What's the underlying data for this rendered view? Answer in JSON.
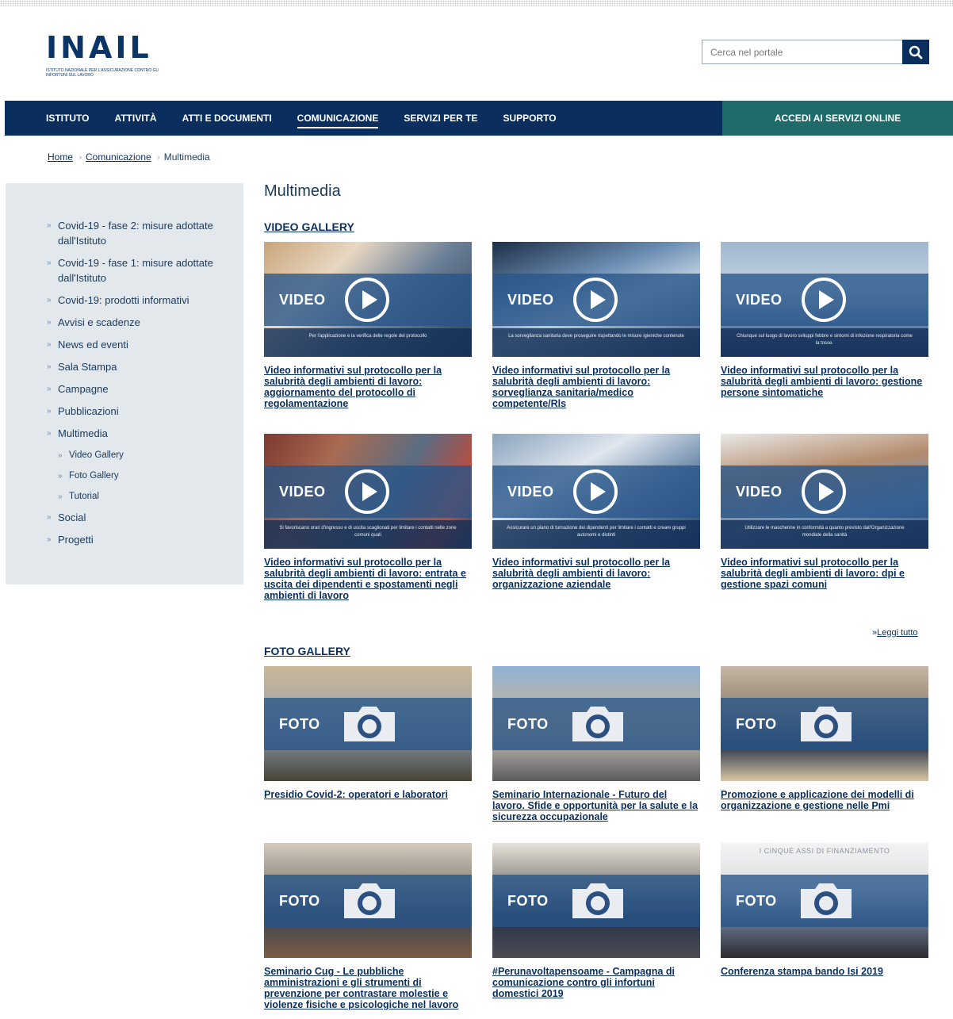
{
  "colors": {
    "brand_navy": "#0a2f5e",
    "cta_teal": "#1f6b6b",
    "sidebar_bg": "#e3e8ec",
    "band_blue": "#265489"
  },
  "logo": {
    "word": "INAIL",
    "subtitle": "Istituto Nazionale per l'Assicurazione contro gli Infortuni sul Lavoro"
  },
  "search": {
    "placeholder": "Cerca nel portale",
    "icon": "search-icon"
  },
  "nav": {
    "items": [
      {
        "label": "ISTITUTO"
      },
      {
        "label": "ATTIVITÀ"
      },
      {
        "label": "ATTI E DOCUMENTI"
      },
      {
        "label": "COMUNICAZIONE",
        "active": true
      },
      {
        "label": "SERVIZI PER TE"
      },
      {
        "label": "SUPPORTO"
      }
    ],
    "cta": "ACCEDI AI SERVIZI ONLINE"
  },
  "breadcrumb": {
    "home": "Home",
    "section": "Comunicazione",
    "current": "Multimedia"
  },
  "sidebar": {
    "items": [
      {
        "label": "Covid-19 - fase 2: misure adottate dall'Istituto"
      },
      {
        "label": "Covid-19 - fase 1: misure adottate dall'Istituto"
      },
      {
        "label": "Covid-19: prodotti informativi"
      },
      {
        "label": "Avvisi e scadenze"
      },
      {
        "label": "News ed eventi"
      },
      {
        "label": "Sala Stampa"
      },
      {
        "label": "Campagne"
      },
      {
        "label": "Pubblicazioni"
      },
      {
        "label": "Multimedia"
      },
      {
        "label": "Video Gallery",
        "sub": true
      },
      {
        "label": "Foto Gallery",
        "sub": true
      },
      {
        "label": "Tutorial",
        "sub": true
      },
      {
        "label": "Social"
      },
      {
        "label": "Progetti"
      }
    ]
  },
  "page_title": "Multimedia",
  "video_gallery": {
    "title": "VIDEO GALLERY",
    "label": "VIDEO",
    "cards": [
      {
        "title": "Video informativi sul protocollo per la salubrità degli ambienti di lavoro: aggiornamento del protocollo di regolamentazione",
        "caption": "Per l'applicazione e la verifica delle regole del protocollo"
      },
      {
        "title": "Video informativi sul protocollo per la salubrità degli ambienti di lavoro: sorveglianza sanitaria/medico competente/Rls",
        "caption": "La sorveglianza sanitaria deve proseguire rispettando le misure igieniche contenute"
      },
      {
        "title": "Video informativi sul protocollo per la salubrità degli ambienti di lavoro: gestione persone sintomatiche",
        "caption": "Chiunque sul luogo di lavoro sviluppi febbre e sintomi di infezione respiratoria come la tosse."
      },
      {
        "title": "Video informativi sul protocollo per la salubrità degli ambienti di lavoro: entrata e uscita dei dipendenti e spostamenti negli ambienti di lavoro",
        "caption": "Si favoriscano orari d'ingresso e di uscita scaglionati per limitare i contatti nelle zone comuni quali"
      },
      {
        "title": "Video informativi sul protocollo per la salubrità degli ambienti di lavoro: organizzazione aziendale",
        "caption": "Assicurare un piano di turnazione dei dipendenti per limitare i contatti e creare gruppi autonomi e distinti"
      },
      {
        "title": "Video informativi sul protocollo per la salubrità degli ambienti di lavoro: dpi e gestione spazi comuni",
        "caption": "Utilizzare le mascherine in conformità a quanto previsto dall'Organizzazione mondiale della sanità"
      }
    ],
    "read_all": "Leggi tutto"
  },
  "photo_gallery": {
    "title": "FOTO GALLERY",
    "label": "FOTO",
    "cards": [
      {
        "title": "Presidio Covid-2: operatori e laboratori"
      },
      {
        "title": "Seminario Internazionale - Futuro del lavoro. Sfide e opportunità per la salute e la sicurezza occupazionale"
      },
      {
        "title": "Promozione e applicazione dei modelli di organizzazione e gestione nelle Pmi"
      },
      {
        "title": "Seminario Cug - Le pubbliche amministrazioni e gli strumenti di prevenzione per contrastare molestie e violenze fisiche e psicologiche nel lavoro"
      },
      {
        "title": "#Perunavoltapensoame - Campagna di comunicazione contro gli infortuni domestici 2019"
      },
      {
        "title": "Conferenza stampa bando Isi 2019",
        "overlay_text": "I CINQUE ASSI DI FINANZIAMENTO"
      }
    ]
  }
}
